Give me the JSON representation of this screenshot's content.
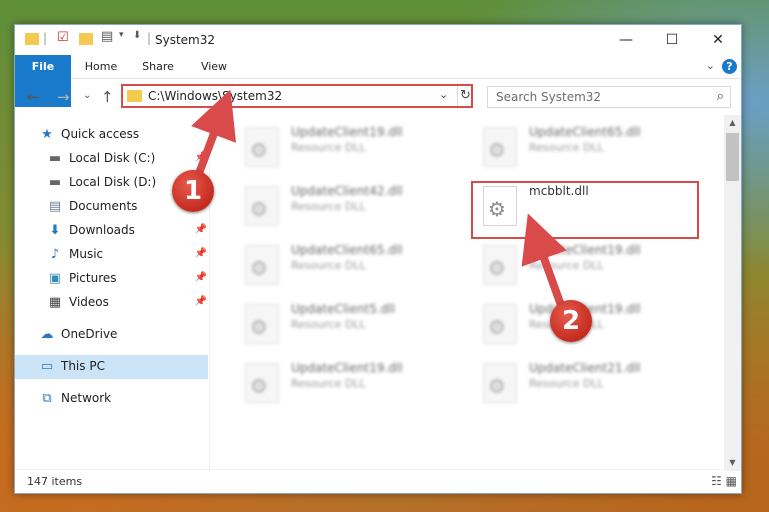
{
  "window": {
    "title": "System32",
    "quick_access_toolbar": [
      "folder-icon",
      "properties-check-icon",
      "new-folder-icon",
      "customize-toolbar-icon"
    ]
  },
  "controls": {
    "minimize": "—",
    "maximize": "☐",
    "close": "✕"
  },
  "ribbon": {
    "tabs": [
      "File",
      "Home",
      "Share",
      "View"
    ],
    "expand_icon": "⌄",
    "help": "?"
  },
  "nav": {
    "back": "←",
    "forward": "→",
    "recent": "⌄",
    "up": "↑"
  },
  "address": {
    "path": "C:\\Windows\\System32",
    "dropdown": "⌄",
    "refresh": "↻"
  },
  "search": {
    "placeholder": "Search System32",
    "icon": "⌕"
  },
  "sidebar": {
    "items": [
      {
        "label": "Quick access",
        "icon": "star-icon",
        "pinned": false
      },
      {
        "label": "Local Disk (C:)",
        "icon": "drive-icon",
        "pinned": true
      },
      {
        "label": "Local Disk (D:)",
        "icon": "drive-icon",
        "pinned": true
      },
      {
        "label": "Documents",
        "icon": "documents-icon",
        "pinned": true
      },
      {
        "label": "Downloads",
        "icon": "downloads-icon",
        "pinned": true
      },
      {
        "label": "Music",
        "icon": "music-icon",
        "pinned": true
      },
      {
        "label": "Pictures",
        "icon": "pictures-icon",
        "pinned": true
      },
      {
        "label": "Videos",
        "icon": "videos-icon",
        "pinned": true
      },
      {
        "label": "OneDrive",
        "icon": "onedrive-icon",
        "pinned": false
      },
      {
        "label": "This PC",
        "icon": "this-pc-icon",
        "pinned": false,
        "selected": true
      },
      {
        "label": "Network",
        "icon": "network-icon",
        "pinned": false
      }
    ]
  },
  "files": {
    "left": [
      {
        "name": "UpdateClient19.dll",
        "type": "Resource DLL"
      },
      {
        "name": "UpdateClient42.dll",
        "type": "Resource DLL"
      },
      {
        "name": "UpdateClient65.dll",
        "type": "Resource DLL"
      },
      {
        "name": "UpdateClient5.dll",
        "type": "Resource DLL"
      },
      {
        "name": "UpdateClient19.dll",
        "type": "Resource DLL"
      }
    ],
    "right": [
      {
        "name": "UpdateClient65.dll",
        "type": "Resource DLL"
      },
      {
        "name": "mcbblt.dll",
        "type": ""
      },
      {
        "name": "UpdateClient19.dll",
        "type": "Resource DLL"
      },
      {
        "name": "UpdateClient19.dll",
        "type": "Resource DLL"
      },
      {
        "name": "UpdateClient21.dll",
        "type": "Resource DLL"
      }
    ]
  },
  "status": {
    "item_count": "147 items"
  },
  "annotations": {
    "marker1": "1",
    "marker2": "2",
    "accent_color": "#d94a4a"
  },
  "colors": {
    "ribbon_file_tab": "#1979ca",
    "selected_nav": "#cce4f7",
    "folder": "#f3c94f"
  }
}
